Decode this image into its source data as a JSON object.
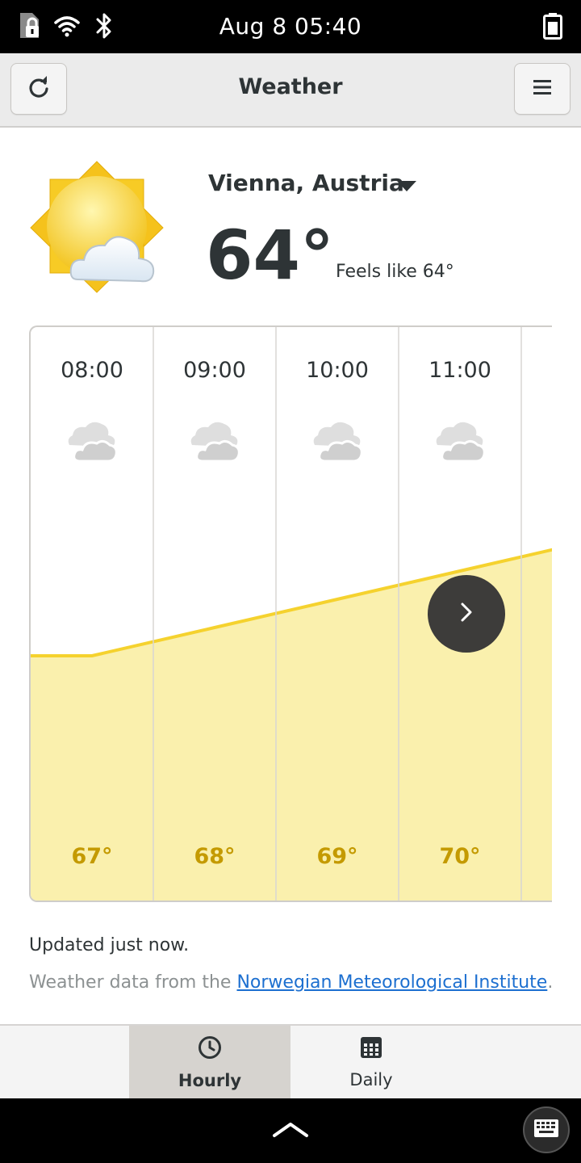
{
  "status_bar": {
    "time": "Aug 8  05:40",
    "icons": [
      "sim-lock-icon",
      "wifi-icon",
      "bluetooth-icon",
      "battery-icon"
    ]
  },
  "header": {
    "title": "Weather",
    "refresh_icon": "refresh-icon",
    "menu_icon": "hamburger-menu-icon"
  },
  "current": {
    "location": "Vienna, Austria",
    "temperature": "64°",
    "feels_like": "Feels like 64°",
    "condition_icon": "sun-behind-cloud-icon"
  },
  "hourly": [
    {
      "time": "08:00",
      "temp": "67°",
      "icon": "cloudy-icon"
    },
    {
      "time": "09:00",
      "temp": "68°",
      "icon": "cloudy-icon"
    },
    {
      "time": "10:00",
      "temp": "69°",
      "icon": "cloudy-icon"
    },
    {
      "time": "11:00",
      "temp": "70°",
      "icon": "cloudy-icon"
    }
  ],
  "footer": {
    "updated": "Updated just now.",
    "source_prefix": "Weather data from the ",
    "source_link": "Norwegian Meteorological Institute",
    "source_suffix": "."
  },
  "tabs": [
    {
      "label": "Hourly",
      "icon": "clock-icon",
      "active": true
    },
    {
      "label": "Daily",
      "icon": "calendar-icon",
      "active": false
    }
  ],
  "colors": {
    "accent_yellow": "#f5d22e",
    "fill_yellow": "#faf0ad",
    "temp_text": "#c49a00",
    "link": "#1c6fd0"
  }
}
